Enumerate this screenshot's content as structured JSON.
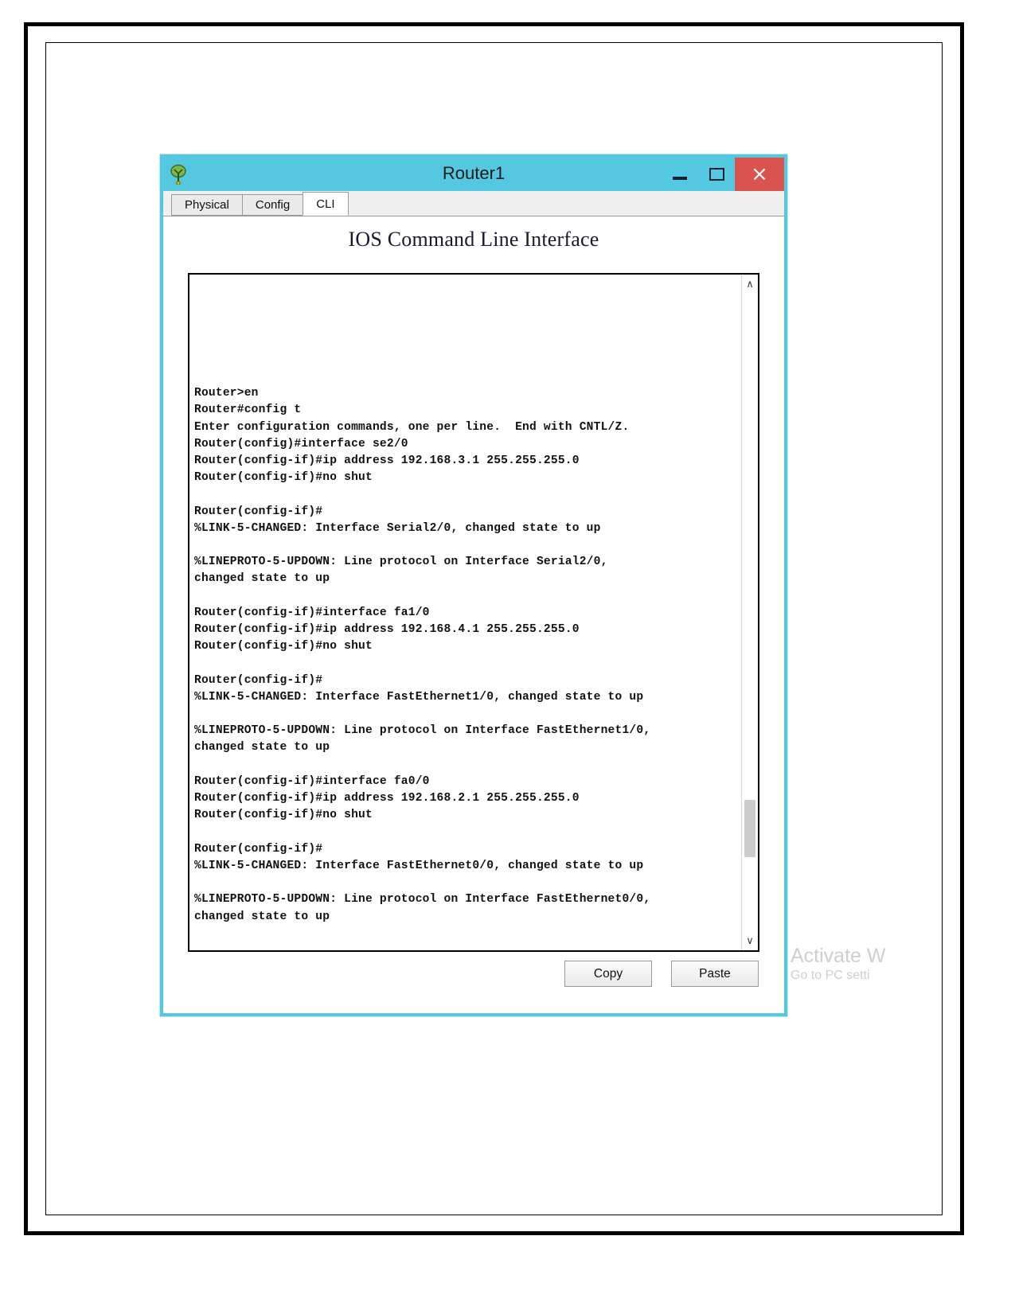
{
  "window": {
    "title": "Router1",
    "icon": "packet-tracer-router-icon",
    "controls": {
      "minimize": "–",
      "maximize": "☐",
      "close": "×"
    },
    "accent_color": "#53c8e0",
    "close_color": "#d9534f"
  },
  "tabs": [
    {
      "label": "Physical",
      "active": false
    },
    {
      "label": "Config",
      "active": false
    },
    {
      "label": "CLI",
      "active": true
    }
  ],
  "cli": {
    "heading": "IOS Command Line Interface",
    "terminal_text": "\n\n\n\n\n\nRouter>en\nRouter#config t\nEnter configuration commands, one per line.  End with CNTL/Z.\nRouter(config)#interface se2/0\nRouter(config-if)#ip address 192.168.3.1 255.255.255.0\nRouter(config-if)#no shut\n\nRouter(config-if)#\n%LINK-5-CHANGED: Interface Serial2/0, changed state to up\n\n%LINEPROTO-5-UPDOWN: Line protocol on Interface Serial2/0,\nchanged state to up\n\nRouter(config-if)#interface fa1/0\nRouter(config-if)#ip address 192.168.4.1 255.255.255.0\nRouter(config-if)#no shut\n\nRouter(config-if)#\n%LINK-5-CHANGED: Interface FastEthernet1/0, changed state to up\n\n%LINEPROTO-5-UPDOWN: Line protocol on Interface FastEthernet1/0,\nchanged state to up\n\nRouter(config-if)#interface fa0/0\nRouter(config-if)#ip address 192.168.2.1 255.255.255.0\nRouter(config-if)#no shut\n\nRouter(config-if)#\n%LINK-5-CHANGED: Interface FastEthernet0/0, changed state to up\n\n%LINEPROTO-5-UPDOWN: Line protocol on Interface FastEthernet0/0,\nchanged state to up\n",
    "scroll_up_glyph": "∧",
    "scroll_down_glyph": "∨"
  },
  "buttons": {
    "copy": "Copy",
    "paste": "Paste"
  },
  "watermark": {
    "line1": "Activate W",
    "line2": "Go to PC setti"
  }
}
